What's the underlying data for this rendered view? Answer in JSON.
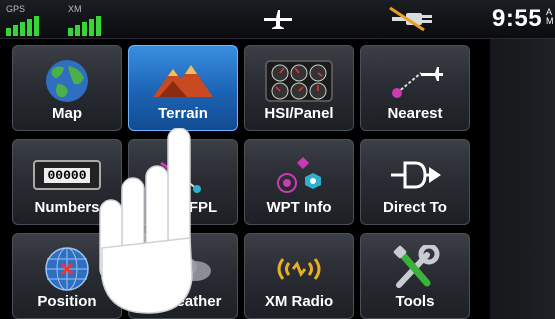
{
  "status_bar": {
    "gps_label": "GPS",
    "xm_label": "XM",
    "time": "9:55",
    "time_suffix_top": "A",
    "time_suffix_bottom": "M"
  },
  "colors": {
    "signal_green": "#38d43a",
    "active_blue": "#1c63b4",
    "button_dark": "#2a2d33"
  },
  "buttons": [
    {
      "label": "Map",
      "icon": "globe-icon",
      "active": false
    },
    {
      "label": "Terrain",
      "icon": "mountain-icon",
      "active": true
    },
    {
      "label": "HSI/Panel",
      "icon": "instrument-panel-icon",
      "active": false
    },
    {
      "label": "Nearest",
      "icon": "nearest-icon",
      "active": false
    },
    {
      "label": "Numbers",
      "icon": "odometer-icon",
      "active": false
    },
    {
      "label": "FPL",
      "icon": "flight-plan-icon",
      "active": false
    },
    {
      "label": "WPT Info",
      "icon": "waypoint-icon",
      "active": false
    },
    {
      "label": "Direct To",
      "icon": "direct-to-icon",
      "active": false
    },
    {
      "label": "Position",
      "icon": "position-icon",
      "active": false
    },
    {
      "label": "Weather",
      "icon": "weather-icon",
      "active": false
    },
    {
      "label": "XM Radio",
      "icon": "xm-radio-icon",
      "active": false
    },
    {
      "label": "Tools",
      "icon": "tools-icon",
      "active": false
    }
  ],
  "odometer_text": "00000"
}
